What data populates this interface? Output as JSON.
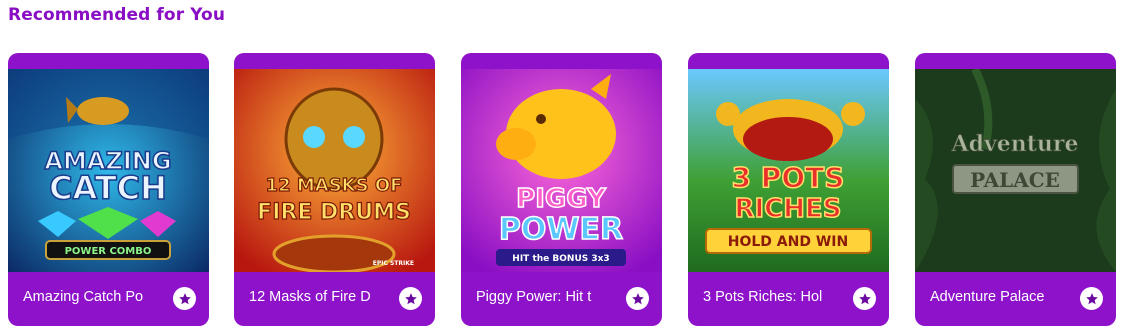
{
  "section": {
    "title": "Recommended for You"
  },
  "games": [
    {
      "name": "Amazing Catch Po",
      "logo_lines": [
        "AMAZING",
        "CATCH"
      ],
      "badge": "POWER COMBO"
    },
    {
      "name": "12 Masks of Fire D",
      "logo_lines": [
        "12 MASKS OF",
        "FIRE DRUMS"
      ],
      "badge": "EPIC STRIKE"
    },
    {
      "name": "Piggy Power: Hit t",
      "logo_lines": [
        "PIGGY",
        "POWER"
      ],
      "badge": "HIT the BONUS 3x3"
    },
    {
      "name": "3 Pots Riches: Hol",
      "logo_lines": [
        "3 POTS",
        "RICHES"
      ],
      "badge": "HOLD AND WIN"
    },
    {
      "name": "Adventure Palace",
      "logo_lines": [
        "Adventure",
        "PALACE"
      ],
      "badge": ""
    }
  ],
  "colors": {
    "accent": "#8a0fc4",
    "card": "#8e12c9",
    "star": "#6b0aa0"
  },
  "icons": {
    "favorite": "star-icon"
  }
}
